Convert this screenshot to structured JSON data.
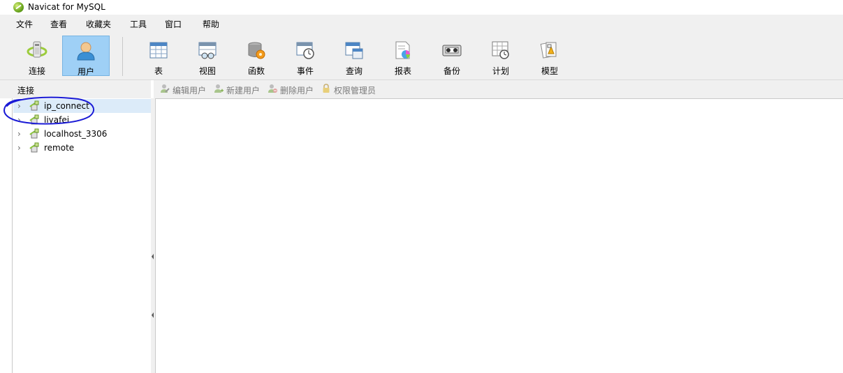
{
  "window": {
    "title": "Navicat for MySQL",
    "app_icon": "navicat-logo-icon"
  },
  "menu": [
    "文件",
    "查看",
    "收藏夹",
    "工具",
    "窗口",
    "帮助"
  ],
  "toolbar": {
    "buttons": [
      {
        "label": "连接",
        "icon": "connection-plug-icon",
        "active": false
      },
      {
        "label": "用户",
        "icon": "user-icon",
        "active": true
      },
      {
        "label": "表",
        "icon": "table-icon",
        "active": false
      },
      {
        "label": "视图",
        "icon": "view-icon",
        "active": false
      },
      {
        "label": "函数",
        "icon": "function-icon",
        "active": false
      },
      {
        "label": "事件",
        "icon": "event-clock-icon",
        "active": false
      },
      {
        "label": "查询",
        "icon": "query-icon",
        "active": false
      },
      {
        "label": "报表",
        "icon": "report-icon",
        "active": false
      },
      {
        "label": "备份",
        "icon": "backup-tape-icon",
        "active": false
      },
      {
        "label": "计划",
        "icon": "schedule-icon",
        "active": false
      },
      {
        "label": "模型",
        "icon": "model-icon",
        "active": false
      }
    ]
  },
  "left_panel": {
    "title": "连接",
    "connections": [
      {
        "name": "ip_connect",
        "selected": true
      },
      {
        "name": "liyafei",
        "selected": false
      },
      {
        "name": "localhost_3306",
        "selected": false
      },
      {
        "name": "remote",
        "selected": false
      }
    ]
  },
  "user_toolbar": {
    "edit_user": "编辑用户",
    "new_user": "新建用户",
    "delete_user": "删除用户",
    "privilege_manager": "权限管理员"
  },
  "colors": {
    "accent": "#9fd0f6",
    "selection": "#dcebf9",
    "annotation": "#1a1ad6"
  }
}
